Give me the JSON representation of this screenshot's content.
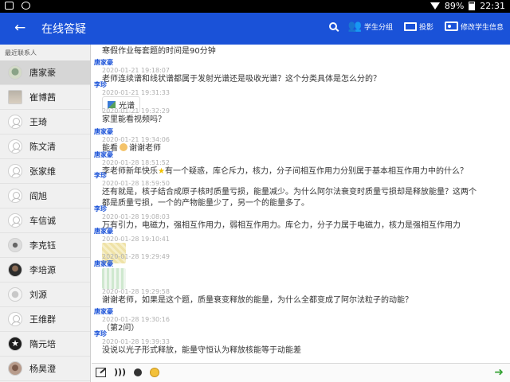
{
  "status_bar": {
    "battery": "89%",
    "clock": "22:31"
  },
  "app_bar": {
    "back_icon": "arrow-left-icon",
    "title": "在线答疑",
    "actions": [
      {
        "icon": "search-icon",
        "label": ""
      },
      {
        "icon": "group-icon",
        "label": "学生分组"
      },
      {
        "icon": "screen-icon",
        "label": "投影"
      },
      {
        "icon": "id-card-icon",
        "label": "修改学生信息"
      }
    ]
  },
  "sidebar": {
    "header": "最近联系人",
    "contacts": [
      {
        "name": "唐家豪",
        "active": true
      },
      {
        "name": "崔博茜"
      },
      {
        "name": "王琦"
      },
      {
        "name": "陈文清"
      },
      {
        "name": "张家维"
      },
      {
        "name": "阎旭"
      },
      {
        "name": "车信诚"
      },
      {
        "name": "李克钰"
      },
      {
        "name": "李培源"
      },
      {
        "name": "刘源"
      },
      {
        "name": "王维群"
      },
      {
        "name": "隋元培"
      },
      {
        "name": "杨昊澄"
      }
    ]
  },
  "chat": {
    "messages": [
      {
        "text": "寒假作业每套题的时间是90分钟"
      },
      {
        "sender": "唐家豪",
        "time": "2020-01-21 19:18:07",
        "text": "老师连续谱和线状谱都属于发射光谱还是吸收光谱？这个分类具体是怎么分的？"
      },
      {
        "sender": "李珍",
        "time": "2020-01-21 19:31:33",
        "attachment": "光谱"
      },
      {
        "time": "2020-01-21 19:32:29",
        "text": "家里能看视频吗？"
      },
      {
        "sender": "唐家豪",
        "time": "2020-01-21 19:34:06",
        "text_before": "能看",
        "text_after": "谢谢老师"
      },
      {
        "sender": "唐家豪",
        "time": "2020-01-28 18:51:52",
        "text_before": "李老师新年快乐",
        "text_after": "有一个疑惑，库仑斥力，核力，分子间相互作用力分别属于基本相互作用力中的什么？"
      },
      {
        "sender": "李珍",
        "time": "2020-01-28 18:59:50",
        "text_line1": "还有就是，核子结合成原子核时质量亏损，能量减少。为什么阿尔法衰变时质量亏损却是释放能量？这两个",
        "text_line2": "都是质量亏损，一个的产物能量少了，另一个的能量多了。"
      },
      {
        "sender": "李珍",
        "time": "2020-01-28 19:08:03",
        "text": "万有引力，电磁力，强相互作用力，弱相互作用力。库仑力，分子力属于电磁力，核力是强相互作用力"
      },
      {
        "sender": "唐家豪",
        "time": "2020-01-28 19:10:41"
      },
      {
        "time": "2020-01-28 19:29:49"
      },
      {
        "sender": "唐家豪",
        "time": "2020-01-28 19:29:58",
        "text": "谢谢老师，如果是这个题，质量衰变释放的能量，为什么全都变成了阿尔法粒子的动能？"
      },
      {
        "sender": "唐家豪",
        "time": "2020-01-28 19:30:16",
        "text": "（第2问）"
      },
      {
        "sender": "李珍",
        "time": "2020-01-28 19:39:33",
        "text": "没说以光子形式释放，能量守恒认为释放核能等于动能差"
      }
    ]
  },
  "input_bar": {
    "tools": [
      "edit-icon",
      "voice-icon",
      "record-icon",
      "emoji-icon"
    ],
    "send_icon": "send-icon"
  },
  "colors": {
    "app_bar": "#1a52d8",
    "sender": "#1a52d8",
    "timestamp": "#b0b0b0",
    "send": "#37a336"
  }
}
